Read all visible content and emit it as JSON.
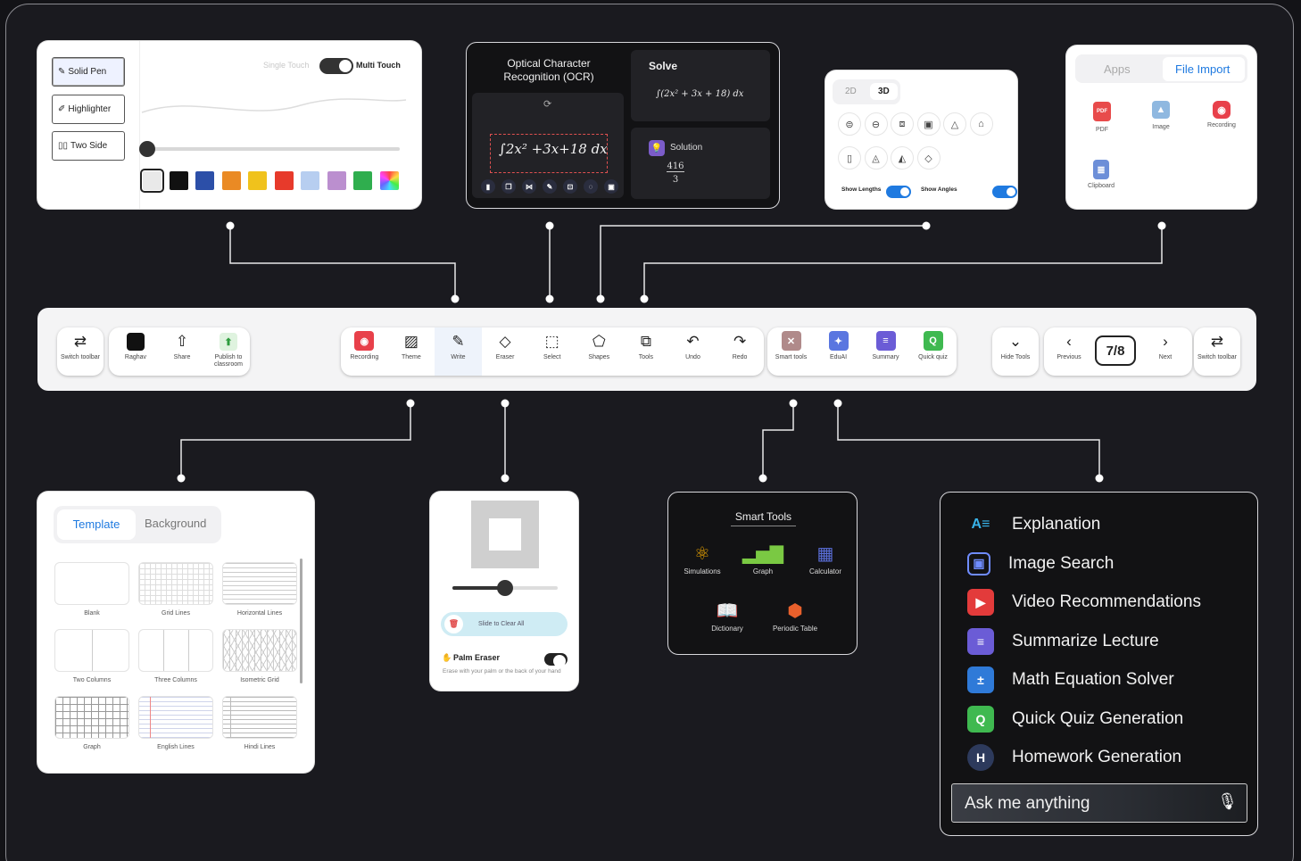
{
  "pen_panel": {
    "buttons": [
      "Solid Pen",
      "Highlighter",
      "Two Side"
    ],
    "touch_single": "Single Touch",
    "touch_multi": "Multi Touch",
    "colors": [
      "#e9e9e9",
      "#111111",
      "#2c4fa8",
      "#ea8a24",
      "#f0c21c",
      "#e73a2b",
      "#b7cef0",
      "#bb8fcf",
      "#2fae4e",
      "rainbow"
    ]
  },
  "ocr_panel": {
    "title": "Optical Character Recognition (OCR)",
    "handwriting": "∫2x² +3x+18 dx",
    "solve_title": "Solve",
    "solve_expr": "∫(2x² + 3x + 18) dx",
    "solution_label": "Solution",
    "solution_num": "416",
    "solution_den": "3"
  },
  "shapes_panel": {
    "tabs": [
      "2D",
      "3D"
    ],
    "show_lengths": "Show Lengths",
    "show_angles": "Show Angles"
  },
  "import_panel": {
    "tabs": [
      "Apps",
      "File Import"
    ],
    "items": [
      "PDF",
      "Image",
      "Recording",
      "Clipboard"
    ],
    "pdf_badge": "PDF"
  },
  "toolbar": {
    "left": [
      {
        "label": "Switch toolbar",
        "icon": "⇄"
      },
      {
        "label": "Raghav",
        "icon": ""
      },
      {
        "label": "Share",
        "icon": "⇧"
      },
      {
        "label": "Publish to classroom",
        "icon": "⬆"
      }
    ],
    "center": [
      {
        "label": "Recording",
        "icon": "◉"
      },
      {
        "label": "Theme",
        "icon": "▨"
      },
      {
        "label": "Write",
        "icon": "✎"
      },
      {
        "label": "Eraser",
        "icon": "◇"
      },
      {
        "label": "Select",
        "icon": "⬚"
      },
      {
        "label": "Shapes",
        "icon": "⬠"
      },
      {
        "label": "Tools",
        "icon": "⧉"
      },
      {
        "label": "Undo",
        "icon": "↶"
      },
      {
        "label": "Redo",
        "icon": "↷"
      }
    ],
    "smart": [
      {
        "label": "Smart tools",
        "icon": "✕"
      },
      {
        "label": "EduAI",
        "icon": "✦"
      },
      {
        "label": "Summary",
        "icon": "≡"
      },
      {
        "label": "Quick quiz",
        "icon": "Q"
      }
    ],
    "right": [
      {
        "label": "Hide Tools",
        "icon": "⌄"
      },
      {
        "label": "Previous",
        "icon": "‹"
      },
      {
        "label": "Next",
        "icon": "›"
      },
      {
        "label": "Switch toolbar",
        "icon": "⇄"
      }
    ],
    "page_indicator": "7/8"
  },
  "template_panel": {
    "tabs": [
      "Template",
      "Background"
    ],
    "items": [
      "Blank",
      "Grid Lines",
      "Horizontal Lines",
      "Two Columns",
      "Three Columns",
      "Isometric Grid",
      "Graph",
      "English Lines",
      "Hindi Lines"
    ]
  },
  "eraser_panel": {
    "slide_label": "Slide to Clear All",
    "palm_title": "Palm Eraser",
    "palm_desc": "Erase with your palm or the back of your hand"
  },
  "smart_tools_panel": {
    "title": "Smart Tools",
    "items": [
      "Simulations",
      "Graph",
      "Calculator",
      "Dictionary",
      "Periodic Table"
    ]
  },
  "ai_panel": {
    "items": [
      "Explanation",
      "Image Search",
      "Video Recommendations",
      "Summarize Lecture",
      "Math Equation Solver",
      "Quick Quiz Generation",
      "Homework Generation"
    ],
    "ask_placeholder": "Ask me anything"
  },
  "colors": {
    "accent": "#1f7ae0",
    "background": "#1a1a1f",
    "recording": "#e8404a",
    "quiz": "#3fb950",
    "summary": "#6b5cd6"
  }
}
